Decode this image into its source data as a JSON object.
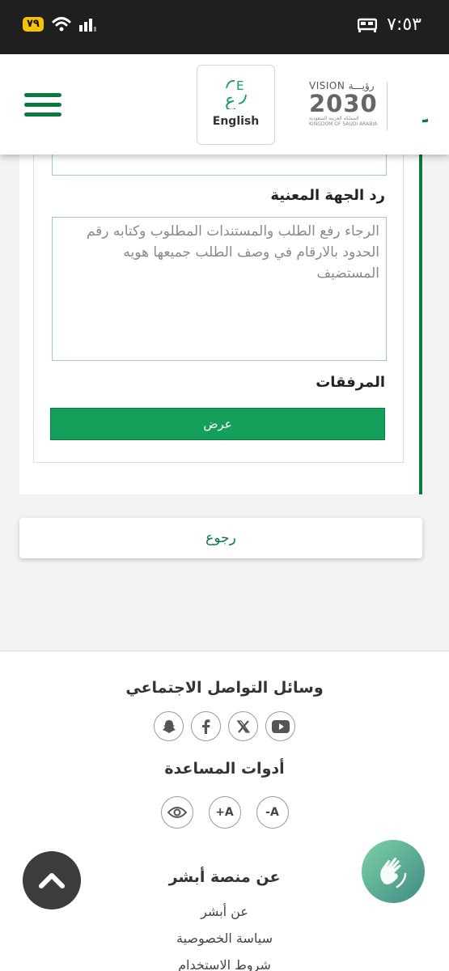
{
  "status_bar": {
    "battery": "٧٩",
    "time": "٧:٥٣"
  },
  "header": {
    "language_button": "English",
    "vision_top": "VISION رؤيـــة",
    "vision_year": "2030",
    "vision_sub_ar": "المملكة العربية السعودية",
    "vision_sub_en": "KINGDOM OF SAUDI ARABIA",
    "absher_logo": "أبشر"
  },
  "form": {
    "reply_label": "رد الجهة المعنية",
    "reply_text": "الرجاء رفع الطلب والمستندات المطلوب وكتابه رقم الحدود بالارقام في وصف الطلب جميعها هويه المستضيف",
    "attachments_label": "المرفقات",
    "view_button": "عرض"
  },
  "back_button": "رجوع",
  "footer": {
    "social_title": "وسائل التواصل الاجتماعي",
    "social_icons": [
      "youtube-icon",
      "x-icon",
      "facebook-icon",
      "snapchat-icon"
    ],
    "tools_title": "أدوات المساعدة",
    "tool_minus": "-A",
    "tool_plus": "+A",
    "about_title": "عن منصة أبشر",
    "links": [
      "عن أبشر",
      "سياسة الخصوصية",
      "شروط الاستخدام"
    ]
  },
  "colors": {
    "brand_green": "#0b7a3e",
    "button_green": "#14a05a"
  }
}
